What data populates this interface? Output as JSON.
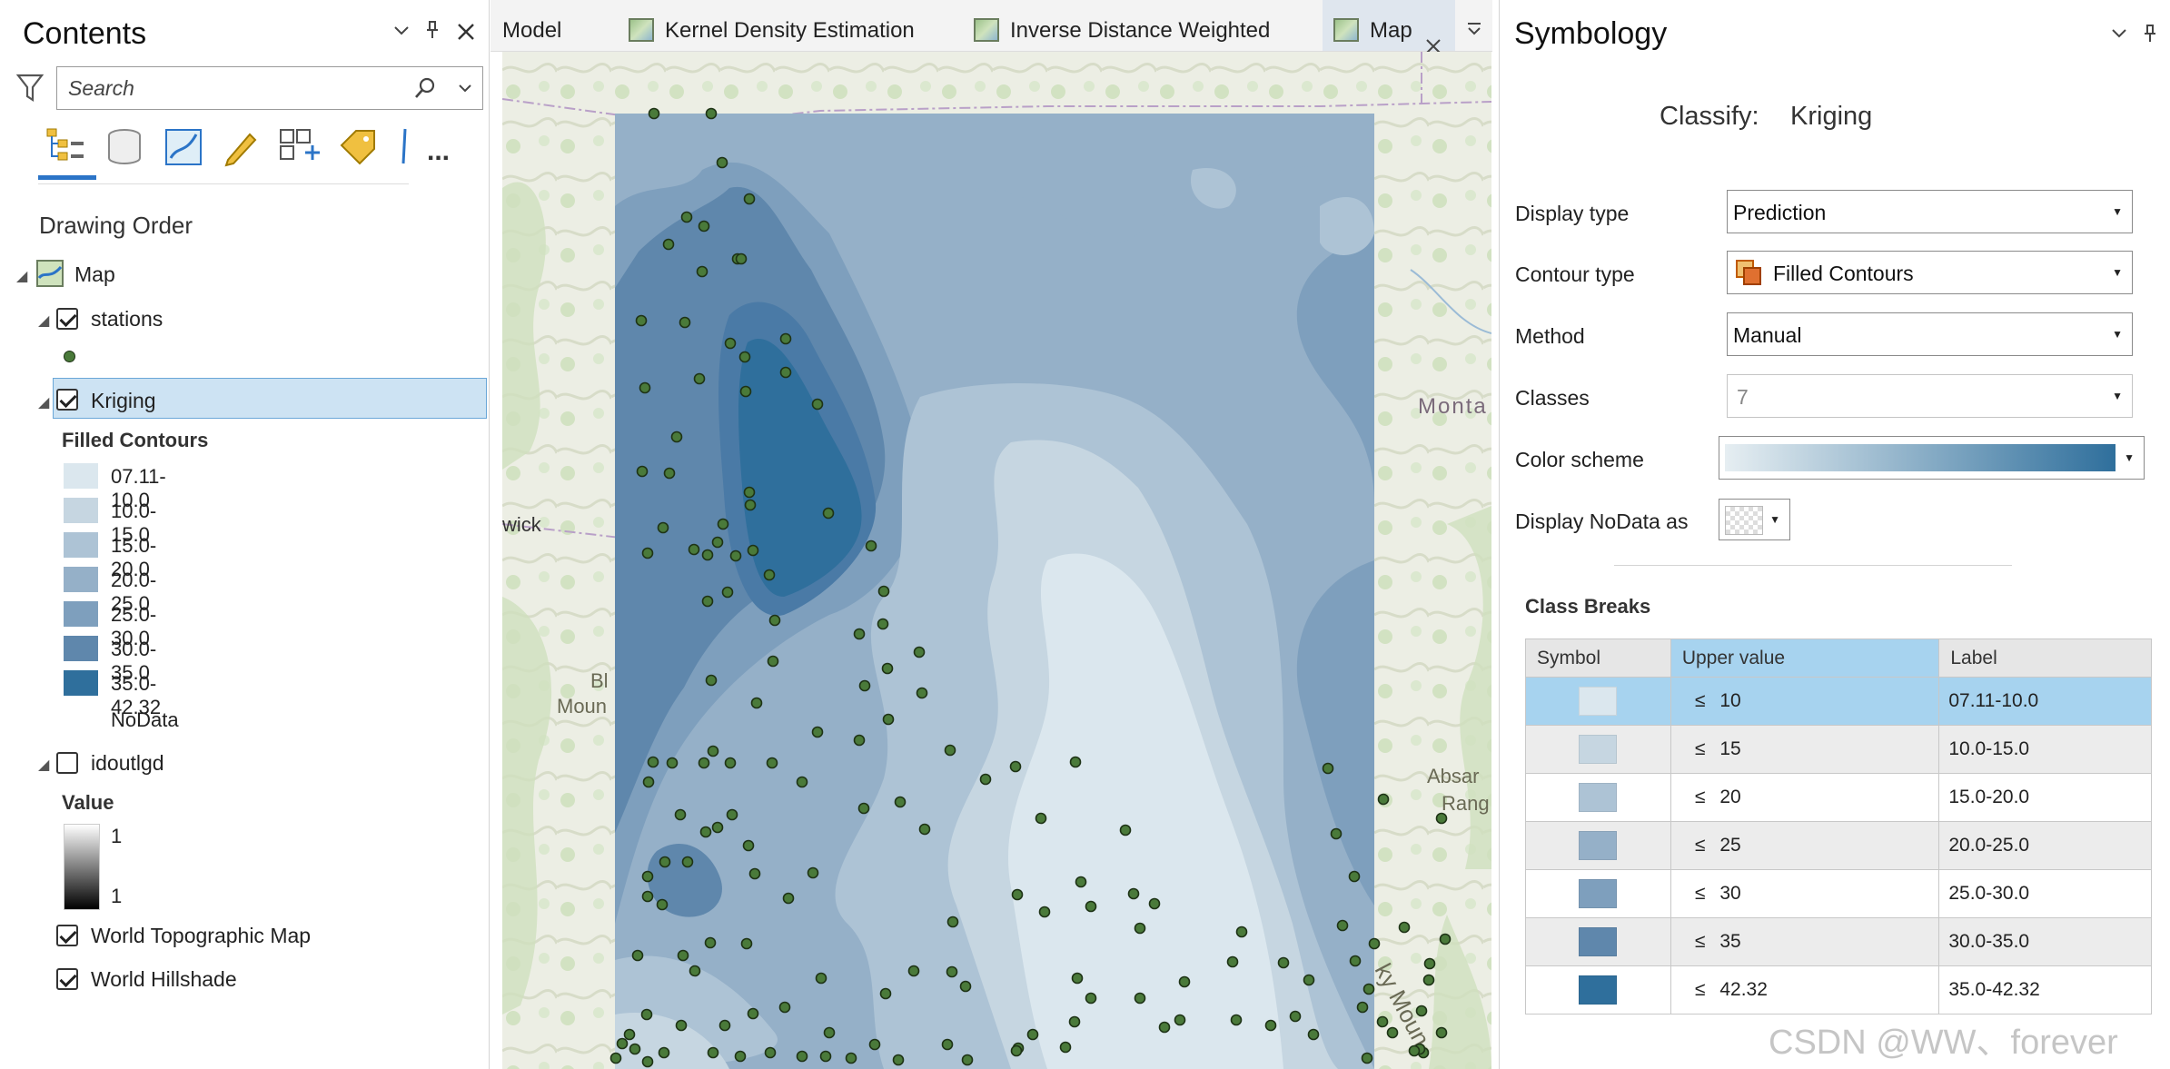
{
  "contents": {
    "title": "Contents",
    "search_placeholder": "Search",
    "drawing_order_label": "Drawing Order",
    "more_label": "...",
    "layers": {
      "map": "Map",
      "stations": "stations",
      "kriging": "Kriging",
      "kriging_subtitle": "Filled Contours",
      "kriging_classes": [
        {
          "label": "07.11-10.0",
          "color": "#dbe7ee"
        },
        {
          "label": "10.0-15.0",
          "color": "#c6d6e1"
        },
        {
          "label": "15.0-20.0",
          "color": "#adc3d5"
        },
        {
          "label": "20.0-25.0",
          "color": "#95b0c8"
        },
        {
          "label": "25.0-30.0",
          "color": "#7e9fbd"
        },
        {
          "label": "30.0-35.0",
          "color": "#5f87ac"
        },
        {
          "label": "35.0-42.32",
          "color": "#2f6f9c"
        }
      ],
      "nodata_label": "NoData",
      "idoutlgd": "idoutlgd",
      "value_label": "Value",
      "value_high": "1",
      "value_low": "1",
      "world_topo": "World Topographic Map",
      "world_hillshade": "World Hillshade"
    }
  },
  "tabs": [
    {
      "label": "Model"
    },
    {
      "label": "Kernel Density Estimation"
    },
    {
      "label": "Inverse Distance Weighted"
    },
    {
      "label": "Map",
      "active": true
    }
  ],
  "map": {
    "labels": {
      "wick": "wick",
      "montana": "Monta",
      "blue_1": "Bl",
      "blue_2": "Moun",
      "absar_1": "Absar",
      "absar_2": "Rang",
      "rocky": "ky Moun"
    },
    "station_color": "#4a7a3a"
  },
  "symbology": {
    "title": "Symbology",
    "classify_label": "Classify:",
    "classify_value": "Kriging",
    "fields": {
      "display_type_label": "Display type",
      "display_type_value": "Prediction",
      "contour_type_label": "Contour type",
      "contour_type_value": "Filled Contours",
      "method_label": "Method",
      "method_value": "Manual",
      "classes_label": "Classes",
      "classes_value": "7",
      "color_scheme_label": "Color scheme",
      "display_nodata_label": "Display NoData as"
    },
    "class_breaks_title": "Class Breaks",
    "table_headers": {
      "symbol": "Symbol",
      "upper": "Upper value",
      "label": "Label"
    },
    "class_rows": [
      {
        "op": "≤",
        "upper": "10",
        "label": "07.11-10.0",
        "color": "#dbe7ee"
      },
      {
        "op": "≤",
        "upper": "15",
        "label": "10.0-15.0",
        "color": "#c6d6e1"
      },
      {
        "op": "≤",
        "upper": "20",
        "label": "15.0-20.0",
        "color": "#adc3d5"
      },
      {
        "op": "≤",
        "upper": "25",
        "label": "20.0-25.0",
        "color": "#95b0c8"
      },
      {
        "op": "≤",
        "upper": "30",
        "label": "25.0-30.0",
        "color": "#7e9fbd"
      },
      {
        "op": "≤",
        "upper": "35",
        "label": "30.0-35.0",
        "color": "#5f87ac"
      },
      {
        "op": "≤",
        "upper": "42.32",
        "label": "35.0-42.32",
        "color": "#2f6f9c"
      }
    ],
    "watermark": "CSDN @WW、forever"
  },
  "colors": {
    "selection": "#a7d3ef",
    "accent": "#2b74c7"
  }
}
